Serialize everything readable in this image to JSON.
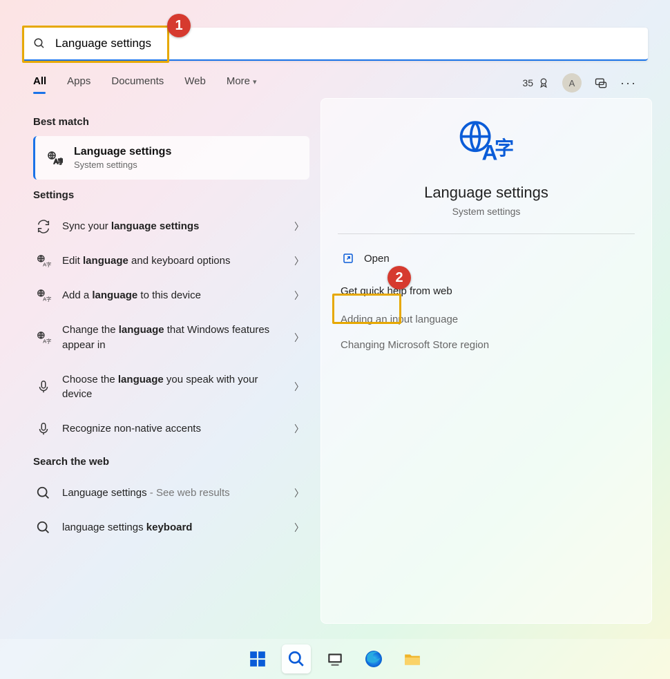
{
  "search": {
    "value": "Language settings"
  },
  "annotations": {
    "badge1": "1",
    "badge2": "2"
  },
  "filters": {
    "tabs": [
      "All",
      "Apps",
      "Documents",
      "Web",
      "More"
    ],
    "active_index": 0
  },
  "header": {
    "points": "35",
    "avatar_initial": "A"
  },
  "best_match": {
    "label": "Best match",
    "title": "Language settings",
    "subtitle": "System settings"
  },
  "settings": {
    "label": "Settings",
    "items": [
      {
        "pre": "Sync your ",
        "bold": "language settings",
        "post": "",
        "icon": "sync"
      },
      {
        "pre": "Edit ",
        "bold": "language",
        "post": " and keyboard options",
        "icon": "lang"
      },
      {
        "pre": "Add a ",
        "bold": "language",
        "post": " to this device",
        "icon": "lang"
      },
      {
        "pre": "Change the ",
        "bold": "language",
        "post": " that Windows features appear in",
        "icon": "lang"
      },
      {
        "pre": "Choose the ",
        "bold": "language",
        "post": " you speak with your device",
        "icon": "mic"
      },
      {
        "pre": "Recognize non-native accents",
        "bold": "",
        "post": "",
        "icon": "mic"
      }
    ]
  },
  "web": {
    "label": "Search the web",
    "items": [
      {
        "pre": "Language settings",
        "suffix": " - See web results",
        "bold": ""
      },
      {
        "pre": "language settings ",
        "suffix": "",
        "bold": "keyboard"
      }
    ]
  },
  "preview": {
    "title": "Language settings",
    "subtitle": "System settings",
    "open_label": "Open",
    "help_label": "Get quick help from web",
    "help_links": [
      "Adding an input language",
      "Changing Microsoft Store region"
    ]
  },
  "taskbar": {
    "items": [
      "start",
      "search",
      "taskview",
      "edge",
      "explorer"
    ],
    "active_index": 1
  }
}
